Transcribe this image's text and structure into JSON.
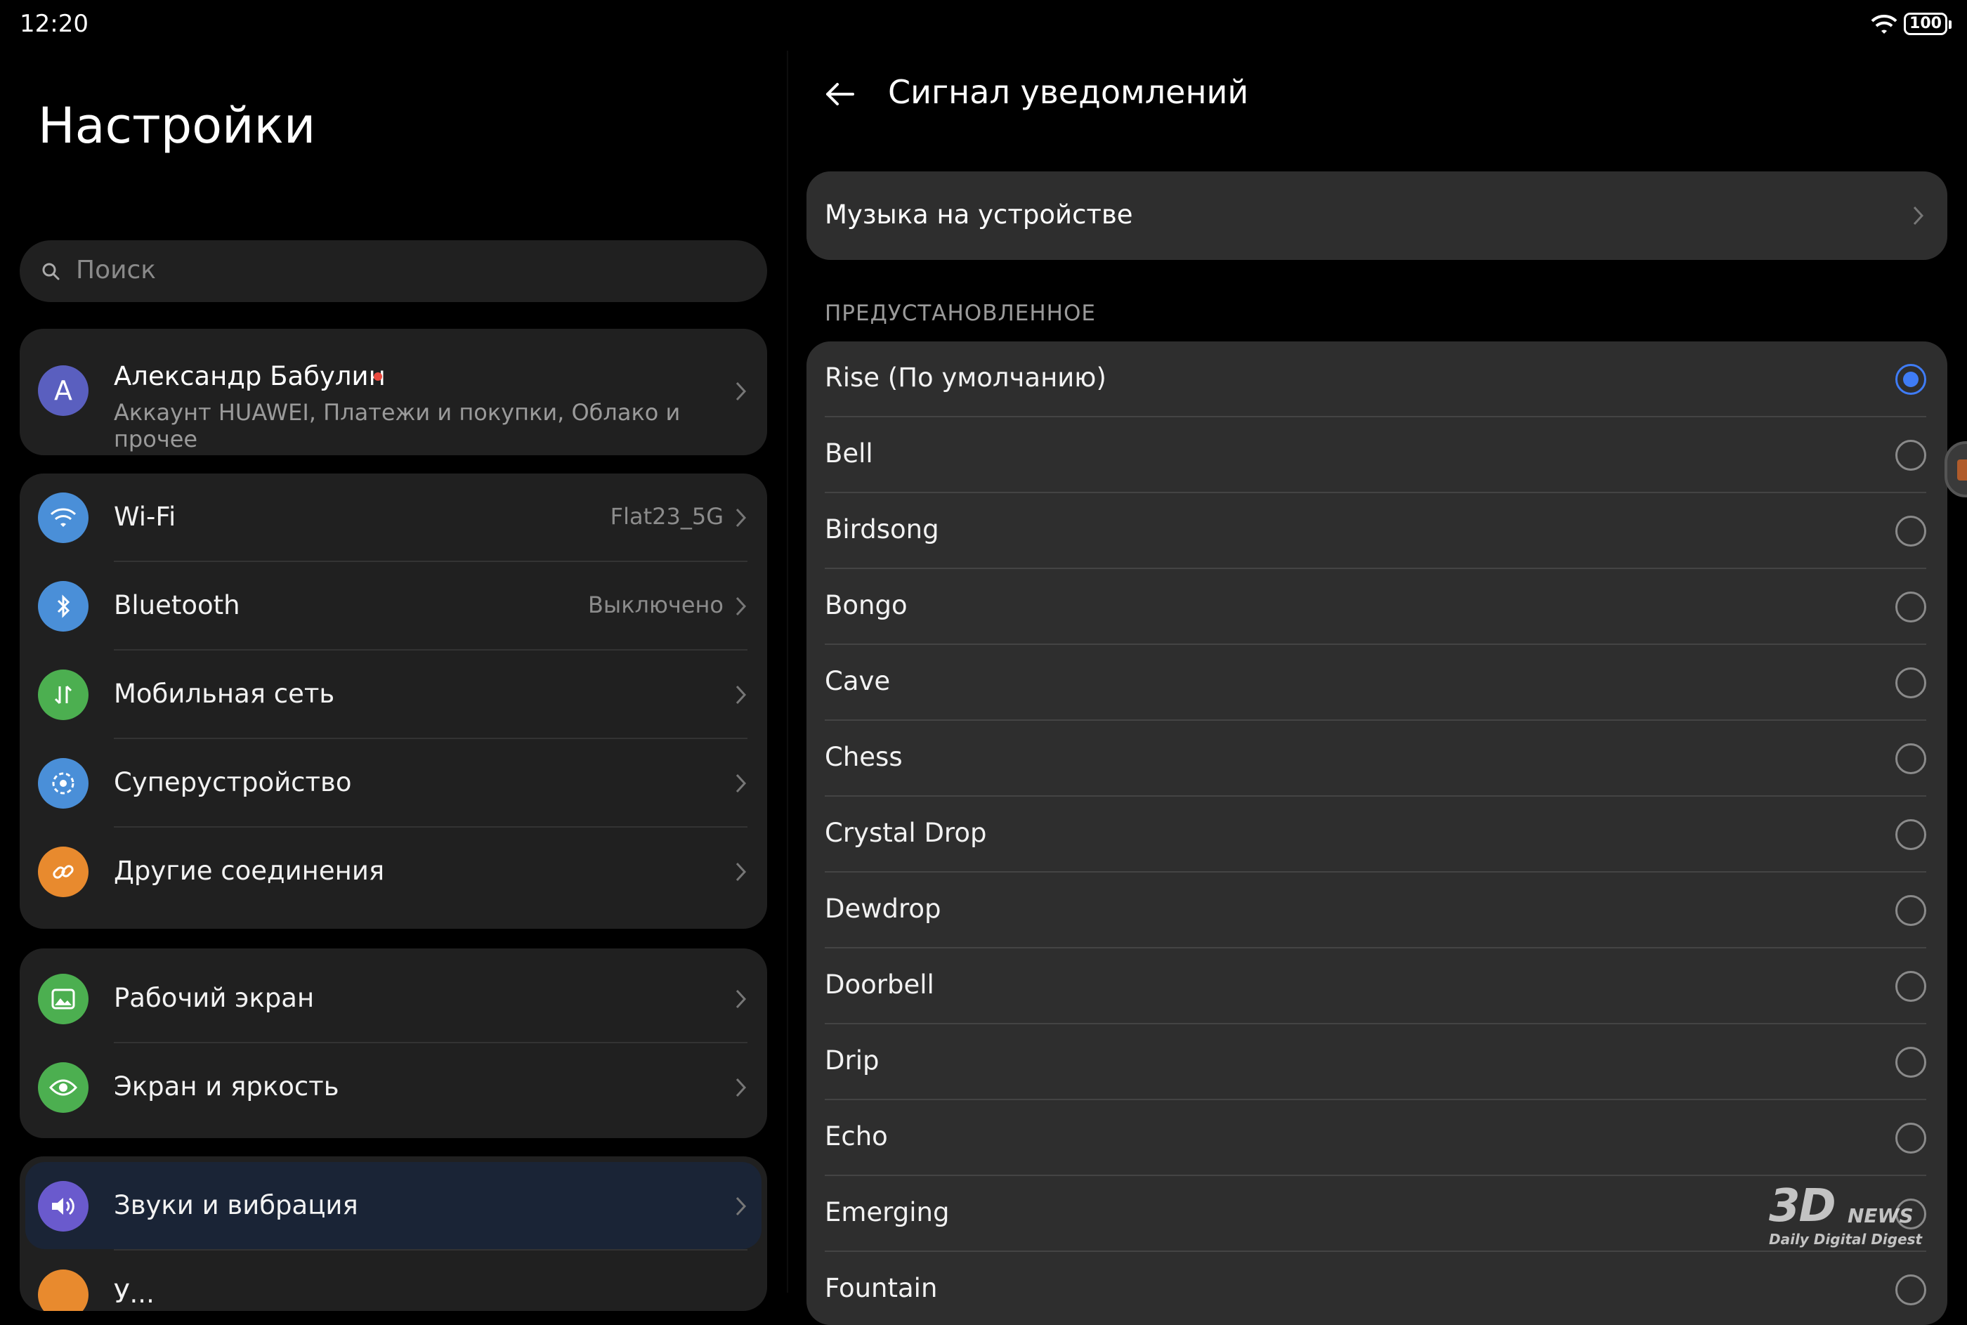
{
  "status": {
    "time": "12:20",
    "battery": "100"
  },
  "left": {
    "title": "Настройки",
    "search_placeholder": "Поиск",
    "account": {
      "avatar_letter": "А",
      "name": "Александр Бабулин",
      "subtitle": "Аккаунт HUAWEI, Платежи и покупки, Облако и прочее"
    },
    "group1": [
      {
        "label": "Wi-Fi",
        "value": "Flat23_5G",
        "icon": "wifi-icon",
        "color": "#4a8fd8"
      },
      {
        "label": "Bluetooth",
        "value": "Выключено",
        "icon": "bluetooth-icon",
        "color": "#4a8fd8"
      },
      {
        "label": "Мобильная сеть",
        "value": "",
        "icon": "mobile-network-icon",
        "color": "#4caf50"
      },
      {
        "label": "Суперустройство",
        "value": "",
        "icon": "super-device-icon",
        "color": "#4a8fd8"
      },
      {
        "label": "Другие соединения",
        "value": "",
        "icon": "link-icon",
        "color": "#e88a2e"
      }
    ],
    "group2": [
      {
        "label": "Рабочий экран",
        "icon": "wallpaper-icon",
        "color": "#4caf50"
      },
      {
        "label": "Экран и яркость",
        "icon": "eye-icon",
        "color": "#4caf50"
      }
    ],
    "group3": [
      {
        "label": "Звуки и вибрация",
        "icon": "sound-icon",
        "color": "#6a5acd"
      },
      {
        "label": "У...",
        "icon": "notifications-icon",
        "color": "#e88a2e"
      }
    ]
  },
  "right": {
    "title": "Сигнал уведомлений",
    "music_label": "Музыка на устройстве",
    "section": "ПРЕДУСТАНОВЛЕННОЕ",
    "tones": [
      {
        "label": "Rise (По умолчанию)",
        "selected": true
      },
      {
        "label": "Bell",
        "selected": false
      },
      {
        "label": "Birdsong",
        "selected": false
      },
      {
        "label": "Bongo",
        "selected": false
      },
      {
        "label": "Cave",
        "selected": false
      },
      {
        "label": "Chess",
        "selected": false
      },
      {
        "label": "Crystal Drop",
        "selected": false
      },
      {
        "label": "Dewdrop",
        "selected": false
      },
      {
        "label": "Doorbell",
        "selected": false
      },
      {
        "label": "Drip",
        "selected": false
      },
      {
        "label": "Echo",
        "selected": false
      },
      {
        "label": "Emerging",
        "selected": false
      },
      {
        "label": "Fountain",
        "selected": false
      }
    ]
  },
  "watermark": {
    "brand": "3D",
    "news": "NEWS",
    "tagline": "Daily Digital Digest"
  }
}
